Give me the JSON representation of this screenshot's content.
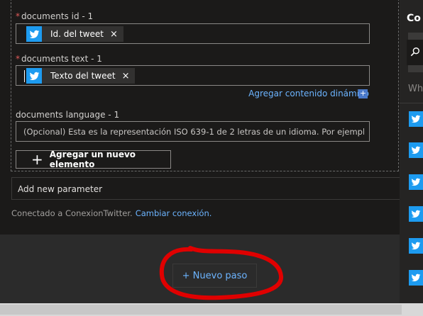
{
  "form": {
    "documents_id": {
      "label": "documents id - 1",
      "required_mark": "*",
      "token": "Id. del tweet",
      "token_remove": "×"
    },
    "documents_text": {
      "label": "documents text - 1",
      "required_mark": "*",
      "token": "Texto del tweet",
      "token_remove": "×"
    },
    "dynamic_content_link": "Agregar contenido dinámico",
    "dynamic_content_icon": "+",
    "documents_language": {
      "label": "documents language - 1",
      "placeholder": "(Opcional) Esta es la representación ISO 639-1 de 2 letras de un idioma. Por ejemplo, utilic"
    },
    "add_item_button": {
      "icon": "+",
      "label": "Agregar un nuevo elemento"
    },
    "add_parameter_label": "Add new parameter",
    "connection": {
      "text": "Conectado a ConexionTwitter.",
      "change_link": "Cambiar conexión."
    }
  },
  "right_panel": {
    "title": "Co",
    "when_text": "Wh",
    "icons": [
      "twitter-icon",
      "twitter-icon",
      "twitter-icon",
      "twitter-icon",
      "twitter-icon",
      "twitter-icon"
    ]
  },
  "new_step_button": "+ Nuevo paso",
  "colors": {
    "twitter_blue": "#1d9bf0",
    "link_blue": "#6cb4ff",
    "annotation_red": "#e00000",
    "card_bg": "#1b1a19",
    "page_bg": "#2b2b2b"
  }
}
